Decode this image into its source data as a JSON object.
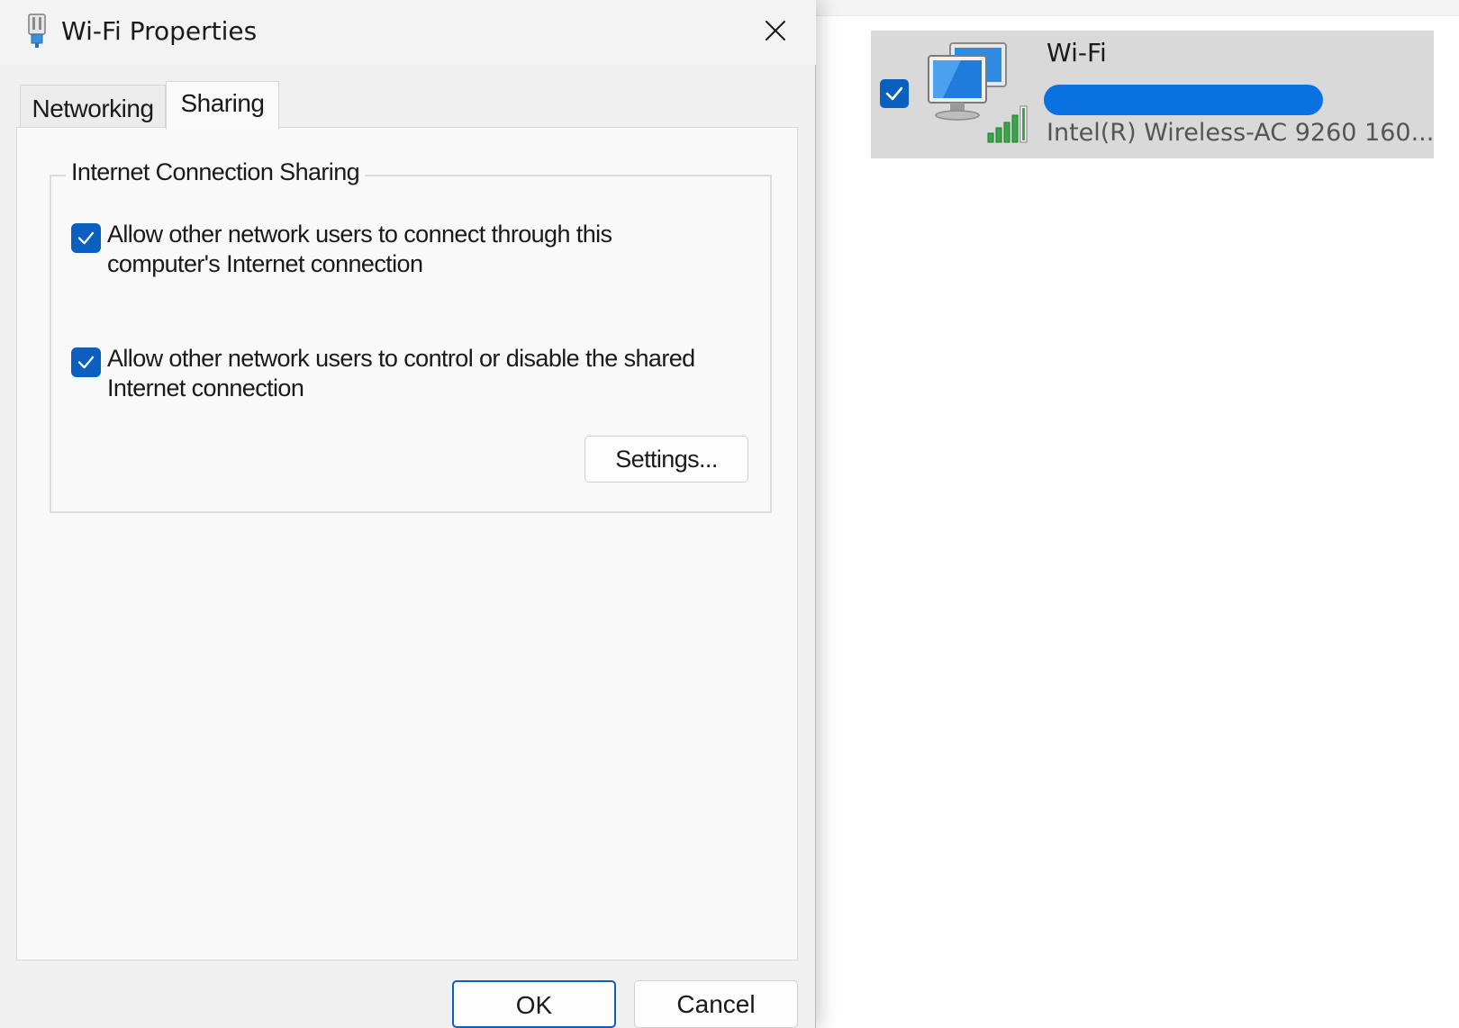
{
  "dialog": {
    "title": "Wi-Fi Properties",
    "tabs": [
      {
        "label": "Networking",
        "selected": false
      },
      {
        "label": "Sharing",
        "selected": true
      }
    ],
    "group_title": "Internet Connection Sharing",
    "options": [
      {
        "label": "Allow other network users to connect through this computer's Internet connection",
        "checked": true
      },
      {
        "label": "Allow other network users to control or disable the shared Internet connection",
        "checked": true
      }
    ],
    "settings_button": "Settings...",
    "ok_button": "OK",
    "cancel_button": "Cancel"
  },
  "adapter": {
    "name": "Wi-Fi",
    "device": "Intel(R) Wireless-AC 9260 160...",
    "checked": true
  },
  "colors": {
    "accent": "#0a5fbf",
    "tile_background": "#d9d9d9",
    "redaction": "#0a72e0",
    "signal_bars": "#3aa64a"
  }
}
